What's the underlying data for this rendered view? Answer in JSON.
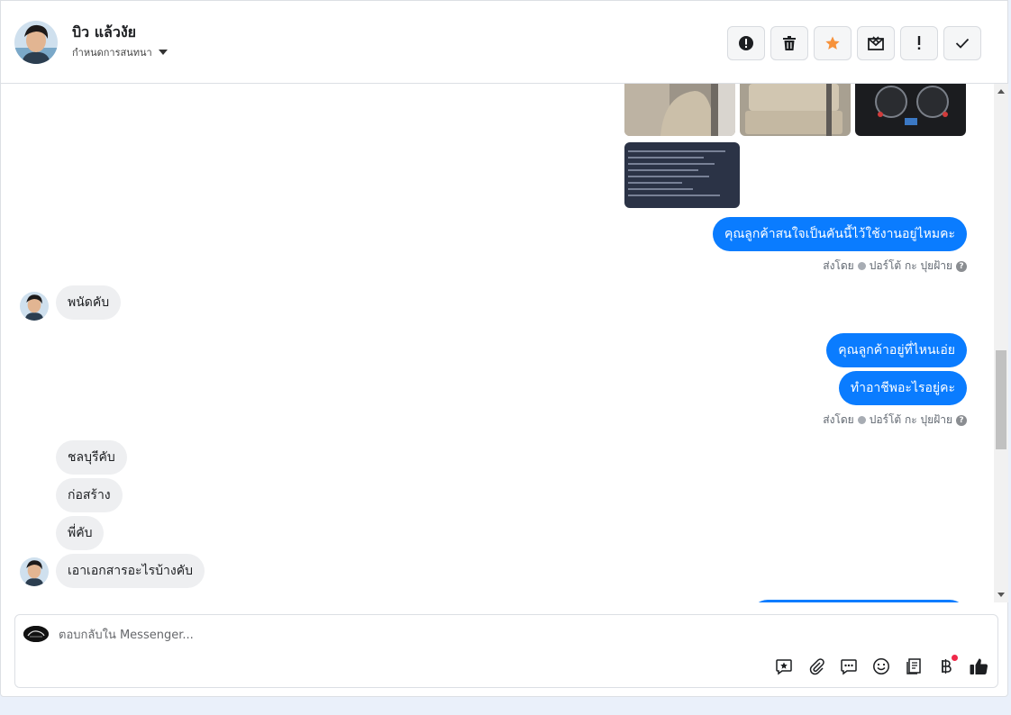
{
  "header": {
    "contact_name": "บิว แล้วงัย",
    "conversation_setting": "กำหนดการสนทนา",
    "toolbar": [
      {
        "name": "report-button",
        "icon": "exclamation-circle-icon"
      },
      {
        "name": "delete-button",
        "icon": "trash-icon"
      },
      {
        "name": "star-button",
        "icon": "star-icon"
      },
      {
        "name": "mark-unread-button",
        "icon": "envelope-x-icon"
      },
      {
        "name": "important-button",
        "icon": "exclamation-icon"
      },
      {
        "name": "done-button",
        "icon": "checkmark-icon"
      }
    ]
  },
  "messages": {
    "out_1": "คุณลูกค้าสนใจเป็นคันนี้ไว้ใช้งานอยู่ไหมคะ",
    "sent_by_label": "ส่งโดย",
    "sent_by_name": "ปอร์โต้ กะ ปุยฝ้าย",
    "in_1": "พนัดคับ",
    "out_2": "คุณลูกค้าอยู่ที่ไหนเอ่ย",
    "out_3": "ทำอาชีพอะไรอยู่คะ",
    "in_2": "ชลบุรีคับ",
    "in_3": "ก่อสร้าง",
    "in_4": "พี่คับ",
    "in_5": "เอาเอกสารอะไรบ้างคับ"
  },
  "reply": {
    "placeholder": "ตอบกลับใน Messenger..."
  },
  "colors": {
    "accent": "#0a7cff",
    "star": "#f7923b",
    "incoming_bubble": "#eeeff1",
    "badge": "#f02849"
  }
}
